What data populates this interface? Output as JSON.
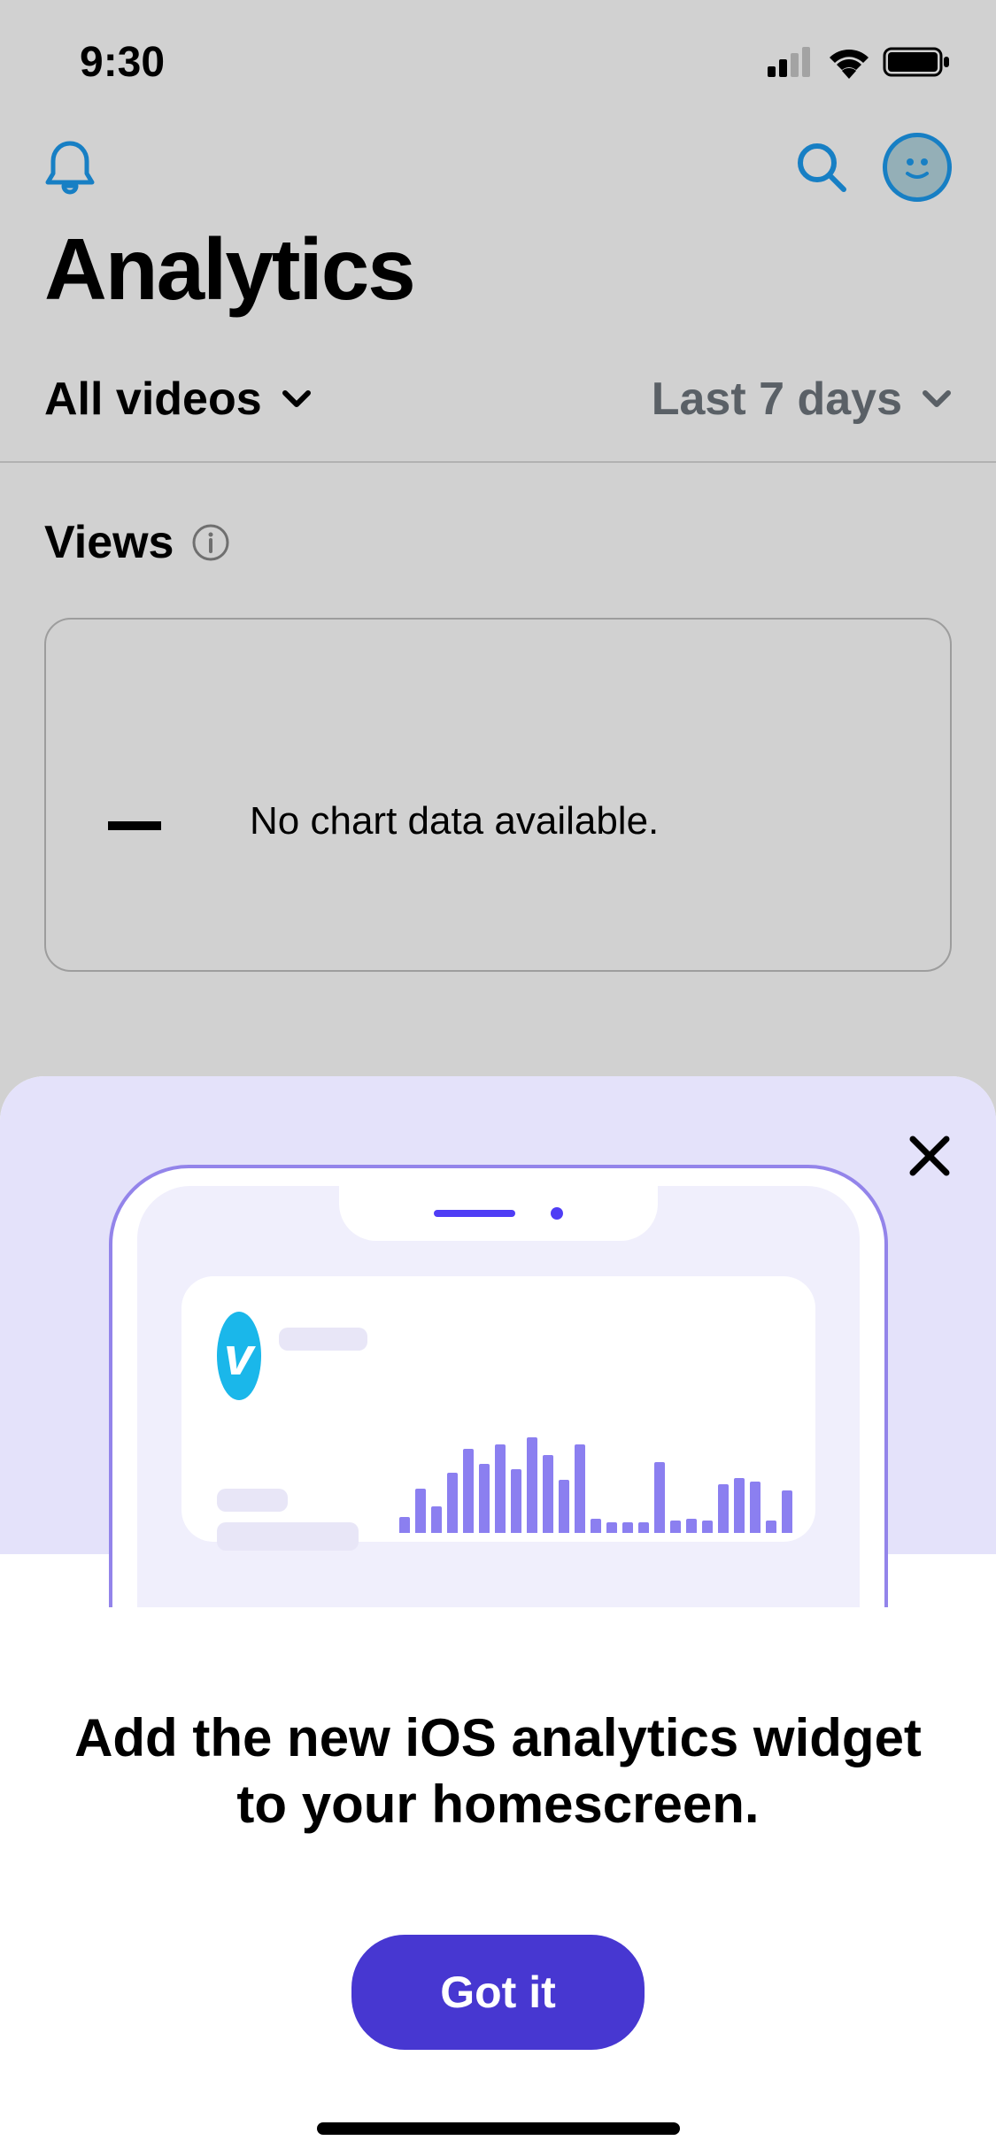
{
  "status": {
    "time": "9:30"
  },
  "page": {
    "title": "Analytics"
  },
  "filters": {
    "scope": "All videos",
    "range": "Last 7 days"
  },
  "section": {
    "views_label": "Views",
    "empty_message": "No chart data available."
  },
  "sheet": {
    "title": "Add the new iOS analytics widget to your homescreen.",
    "button_label": "Got it"
  }
}
